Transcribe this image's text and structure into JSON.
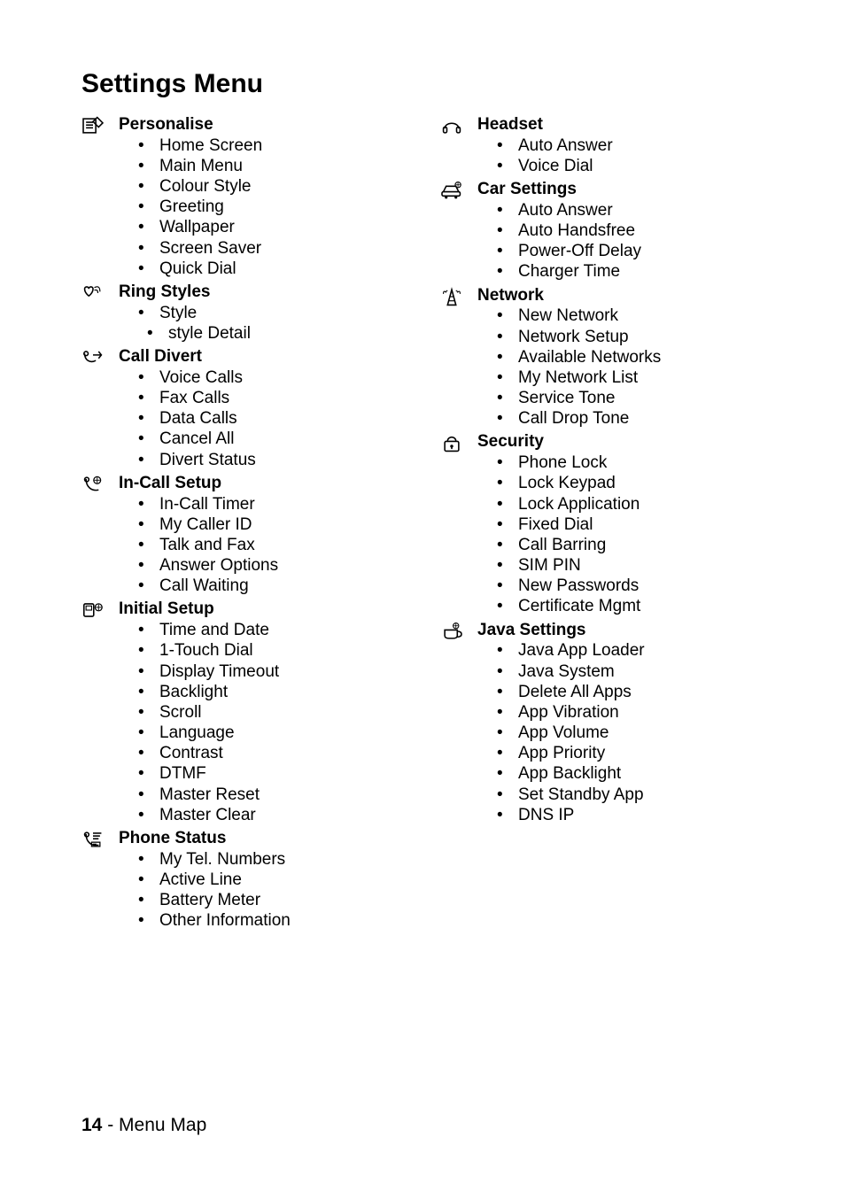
{
  "page": {
    "title": "Settings Menu",
    "footer_page": "14",
    "footer_sep": " - ",
    "footer_section": "Menu Map"
  },
  "sections_left": [
    {
      "icon": "menu-list-icon",
      "title": "Personalise",
      "items": [
        "Home Screen",
        "Main Menu",
        "Colour Style",
        "Greeting",
        "Wallpaper",
        "Screen Saver",
        "Quick Dial"
      ]
    },
    {
      "icon": "bell-heart-icon",
      "title": "Ring Styles",
      "items": [
        "Style",
        " style Detail"
      ],
      "indented": [
        1
      ]
    },
    {
      "icon": "divert-icon",
      "title": "Call Divert",
      "items": [
        "Voice Calls",
        "Fax Calls",
        "Data Calls",
        "Cancel All",
        "Divert Status"
      ]
    },
    {
      "icon": "incall-icon",
      "title": "In-Call Setup",
      "items": [
        "In-Call Timer",
        "My Caller ID",
        "Talk and Fax",
        "Answer Options",
        "Call Waiting"
      ]
    },
    {
      "icon": "initial-setup-icon",
      "title": "Initial Setup",
      "items": [
        "Time and Date",
        "1-Touch Dial",
        "Display Timeout",
        "Backlight",
        "Scroll",
        "Language",
        "Contrast",
        "DTMF",
        "Master Reset",
        "Master Clear"
      ]
    },
    {
      "icon": "phone-status-icon",
      "title": "Phone Status",
      "items": [
        "My Tel. Numbers",
        "Active Line",
        "Battery Meter",
        "Other Information"
      ]
    }
  ],
  "sections_right": [
    {
      "icon": "headset-icon",
      "title": "Headset",
      "items": [
        "Auto Answer",
        "Voice Dial"
      ]
    },
    {
      "icon": "car-icon",
      "title": "Car Settings",
      "items": [
        "Auto Answer",
        "Auto Handsfree",
        "Power-Off Delay",
        "Charger Time"
      ]
    },
    {
      "icon": "network-icon",
      "title": "Network",
      "items": [
        "New Network",
        "Network Setup",
        "Available Networks",
        "My Network List",
        "Service Tone",
        "Call Drop Tone"
      ]
    },
    {
      "icon": "security-icon",
      "title": "Security",
      "items": [
        "Phone Lock",
        "Lock Keypad",
        "Lock Application",
        "Fixed Dial",
        "Call Barring",
        "SIM PIN",
        "New Passwords",
        "Certificate Mgmt"
      ]
    },
    {
      "icon": "java-icon",
      "title": "Java Settings",
      "items": [
        "Java App Loader",
        "Java System",
        "Delete All Apps",
        "App Vibration",
        "App Volume",
        "App Priority",
        "App Backlight",
        "Set Standby App",
        "DNS IP"
      ]
    }
  ]
}
